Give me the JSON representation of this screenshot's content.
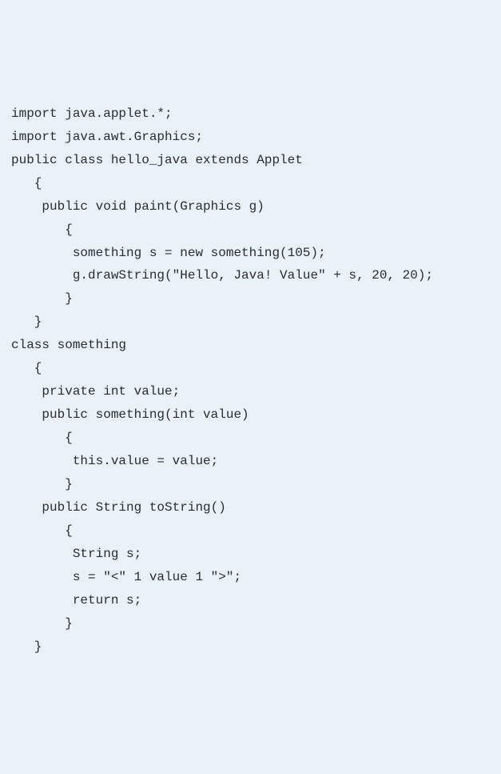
{
  "code": {
    "lines": [
      "import java.applet.*;",
      "import java.awt.Graphics;",
      "public class hello_java extends Applet",
      "   {",
      "    public void paint(Graphics g)",
      "       {",
      "        something s = new something(105);",
      "        g.drawString(\"Hello, Java! Value\" + s, 20, 20);",
      "       }",
      "   }",
      "class something",
      "   {",
      "    private int value;",
      "    public something(int value)",
      "       {",
      "        this.value = value;",
      "       }",
      "    public String toString()",
      "       {",
      "        String s;",
      "        s = \"<\" 1 value 1 \">\";",
      "        return s;",
      "       }",
      "   }"
    ]
  }
}
